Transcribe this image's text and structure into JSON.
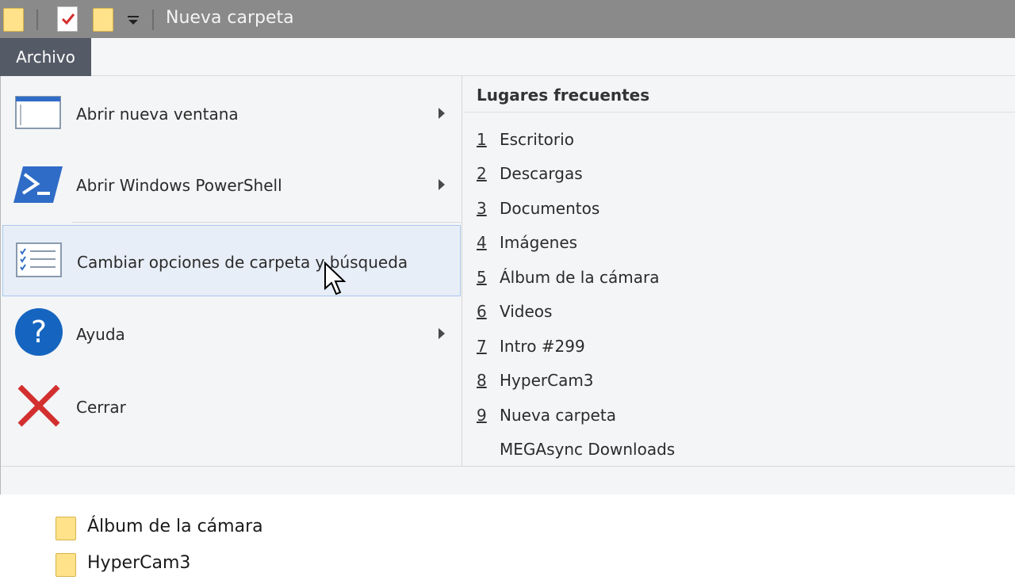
{
  "window": {
    "title": "Nueva carpeta"
  },
  "quick_access": {
    "icons": [
      "folder-icon",
      "properties-icon",
      "new-folder-icon",
      "customize-dropdown-icon"
    ]
  },
  "ribbon": {
    "file_tab": "Archivo"
  },
  "file_menu": {
    "items": [
      {
        "label": "Abrir nueva ventana",
        "icon": "new-window-icon",
        "has_submenu": true
      },
      {
        "label": "Abrir Windows PowerShell",
        "icon": "powershell-icon",
        "has_submenu": true
      },
      {
        "label": "Cambiar opciones de carpeta y búsqueda",
        "icon": "folder-options-icon",
        "has_submenu": false,
        "highlighted": true
      },
      {
        "label": "Ayuda",
        "icon": "help-icon",
        "has_submenu": true
      },
      {
        "label": "Cerrar",
        "icon": "close-icon",
        "has_submenu": false
      }
    ]
  },
  "frequent_places": {
    "header": "Lugares frecuentes",
    "items": [
      {
        "num": "1",
        "label": "Escritorio"
      },
      {
        "num": "2",
        "label": "Descargas"
      },
      {
        "num": "3",
        "label": "Documentos"
      },
      {
        "num": "4",
        "label": "Imágenes"
      },
      {
        "num": "5",
        "label": "Álbum de la cámara"
      },
      {
        "num": "6",
        "label": "Videos"
      },
      {
        "num": "7",
        "label": "Intro #299"
      },
      {
        "num": "8",
        "label": "HyperCam3"
      },
      {
        "num": "9",
        "label": "Nueva carpeta"
      },
      {
        "num": "",
        "label": "MEGAsync Downloads"
      }
    ]
  },
  "background_list": {
    "items": [
      {
        "label": "Álbum de la cámara"
      },
      {
        "label": "HyperCam3"
      }
    ]
  },
  "colors": {
    "titlebar": "#8a8a8a",
    "file_tab": "#545a66",
    "menu_bg": "#f4f5f7",
    "hover_bg": "#e8eef7",
    "hover_border": "#a9c7ec",
    "folder": "#ffe28a",
    "powershell": "#2f6cc7",
    "help": "#1565c0",
    "close": "#d32f2f"
  }
}
